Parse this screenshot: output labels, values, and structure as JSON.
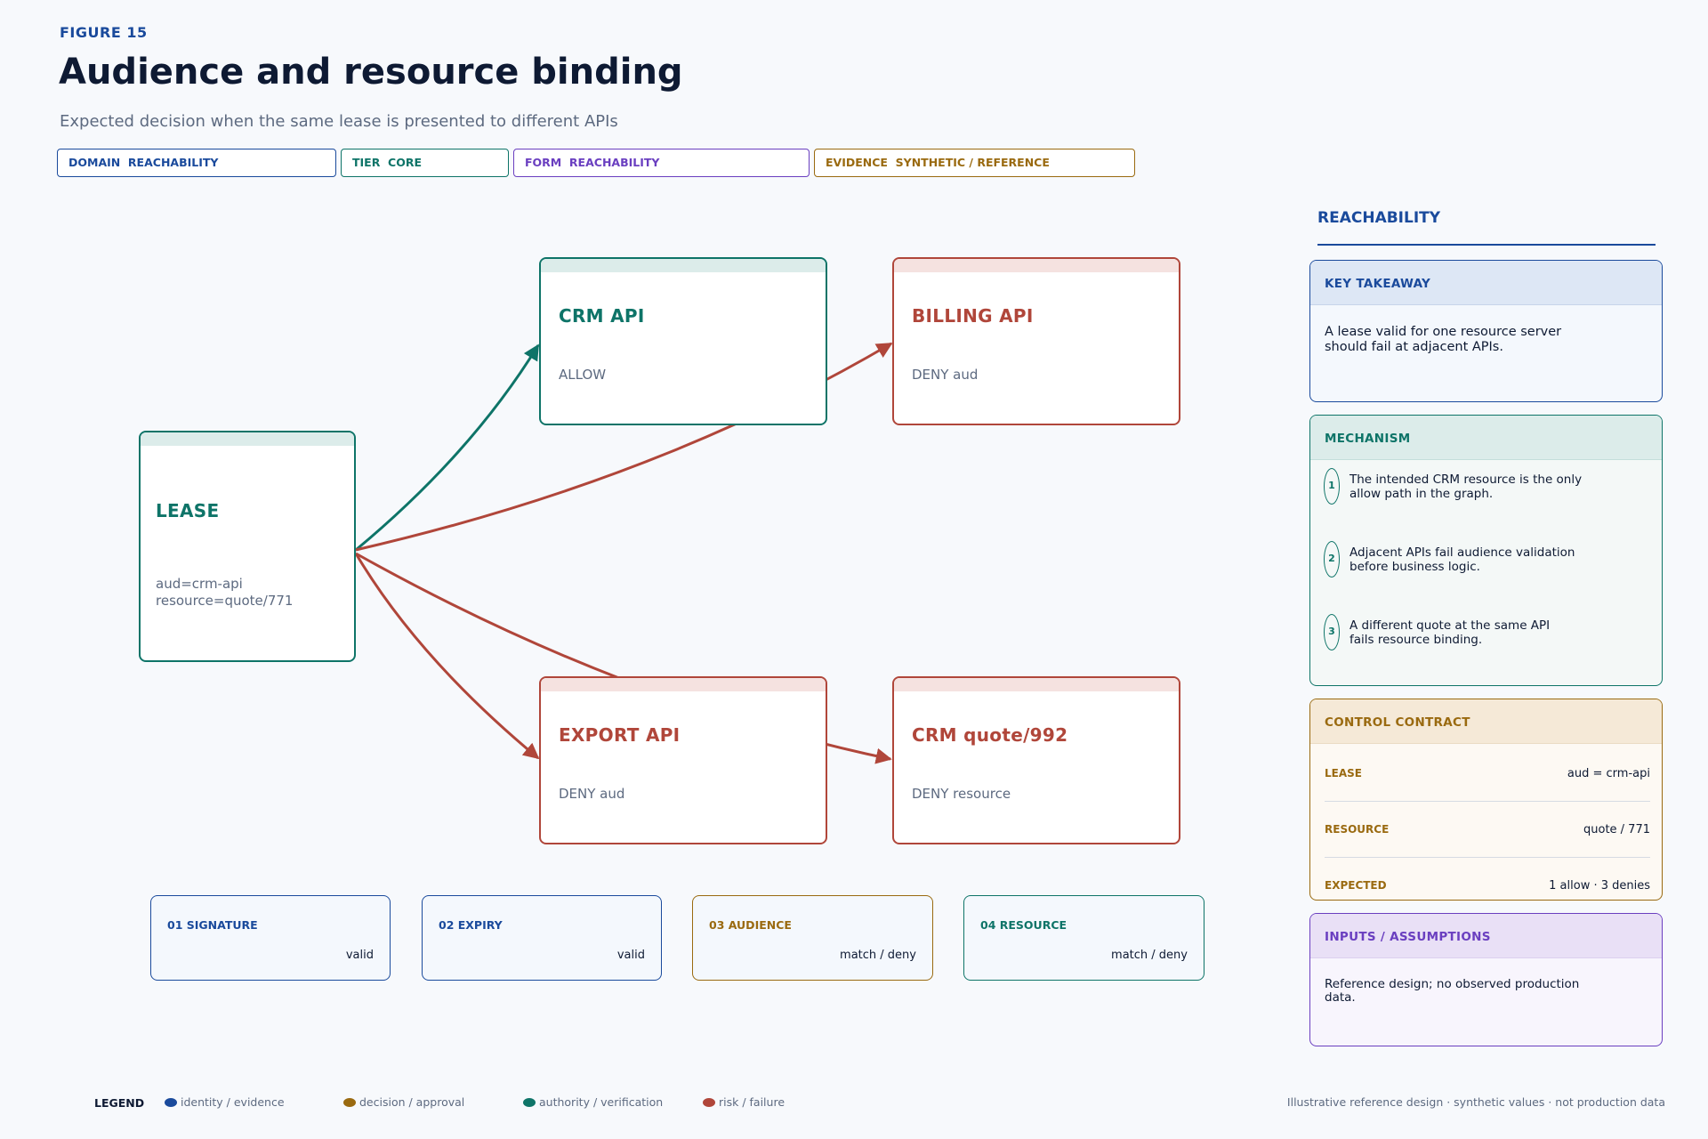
{
  "header": {
    "figure_label": "FIGURE 15",
    "title": "Audience and resource binding",
    "subtitle": "Expected decision when the same lease is presented to different APIs"
  },
  "tags": [
    {
      "text": "DOMAIN  REACHABILITY",
      "color": "#1a4a9c"
    },
    {
      "text": "TIER  CORE",
      "color": "#0e7468"
    },
    {
      "text": "FORM  REACHABILITY",
      "color": "#6a3fc0"
    },
    {
      "text": "EVIDENCE  SYNTHETIC / REFERENCE",
      "color": "#9a6a10"
    }
  ],
  "nodes": {
    "lease": {
      "title": "LEASE",
      "subtitle": "aud=crm-api\nresource=quote/771"
    },
    "crm_api": {
      "title": "CRM API",
      "subtitle": "ALLOW"
    },
    "billing_api": {
      "title": "BILLING API",
      "subtitle": "DENY aud"
    },
    "export_api": {
      "title": "EXPORT API",
      "subtitle": "DENY aud"
    },
    "crm_quote": {
      "title": "CRM quote/992",
      "subtitle": "DENY resource"
    }
  },
  "steps": [
    {
      "label": "01 SIGNATURE",
      "value": "valid"
    },
    {
      "label": "02 EXPIRY",
      "value": "valid"
    },
    {
      "label": "03 AUDIENCE",
      "value": "match / deny"
    },
    {
      "label": "04 RESOURCE",
      "value": "match / deny"
    }
  ],
  "panel": {
    "heading": "REACHABILITY",
    "key_takeaway": {
      "title": "KEY TAKEAWAY",
      "line1": "A lease valid for one resource server",
      "line2": "should fail at adjacent APIs."
    },
    "mechanism": {
      "title": "MECHANISM",
      "items": [
        {
          "num": "1",
          "line1": "The intended CRM resource is the only",
          "line2": "allow path in the graph."
        },
        {
          "num": "2",
          "line1": "Adjacent APIs fail audience validation",
          "line2": "before business logic."
        },
        {
          "num": "3",
          "line1": "A different quote at the same API",
          "line2": "fails resource binding."
        }
      ]
    },
    "control_contract": {
      "title": "CONTROL CONTRACT",
      "rows": [
        {
          "key": "LEASE",
          "value": "aud = crm-api"
        },
        {
          "key": "RESOURCE",
          "value": "quote / 771"
        },
        {
          "key": "EXPECTED",
          "value": "1 allow · 3 denies"
        }
      ]
    },
    "inputs": {
      "title": "INPUTS / ASSUMPTIONS",
      "line1": "Reference design; no observed production",
      "line2": "data."
    }
  },
  "legend": {
    "title": "LEGEND",
    "items": [
      {
        "label": "identity / evidence",
        "color": "#1a4a9c"
      },
      {
        "label": "decision / approval",
        "color": "#9a6a10"
      },
      {
        "label": "authority / verification",
        "color": "#0e7468"
      },
      {
        "label": "risk / failure",
        "color": "#b0463a"
      }
    ]
  },
  "footer_note": "Illustrative reference design · synthetic values · not production data",
  "colors": {
    "blue": "#1a4a9c",
    "teal": "#0e7468",
    "red": "#b0463a",
    "amber": "#9a6a10",
    "purple": "#6a3fc0"
  }
}
